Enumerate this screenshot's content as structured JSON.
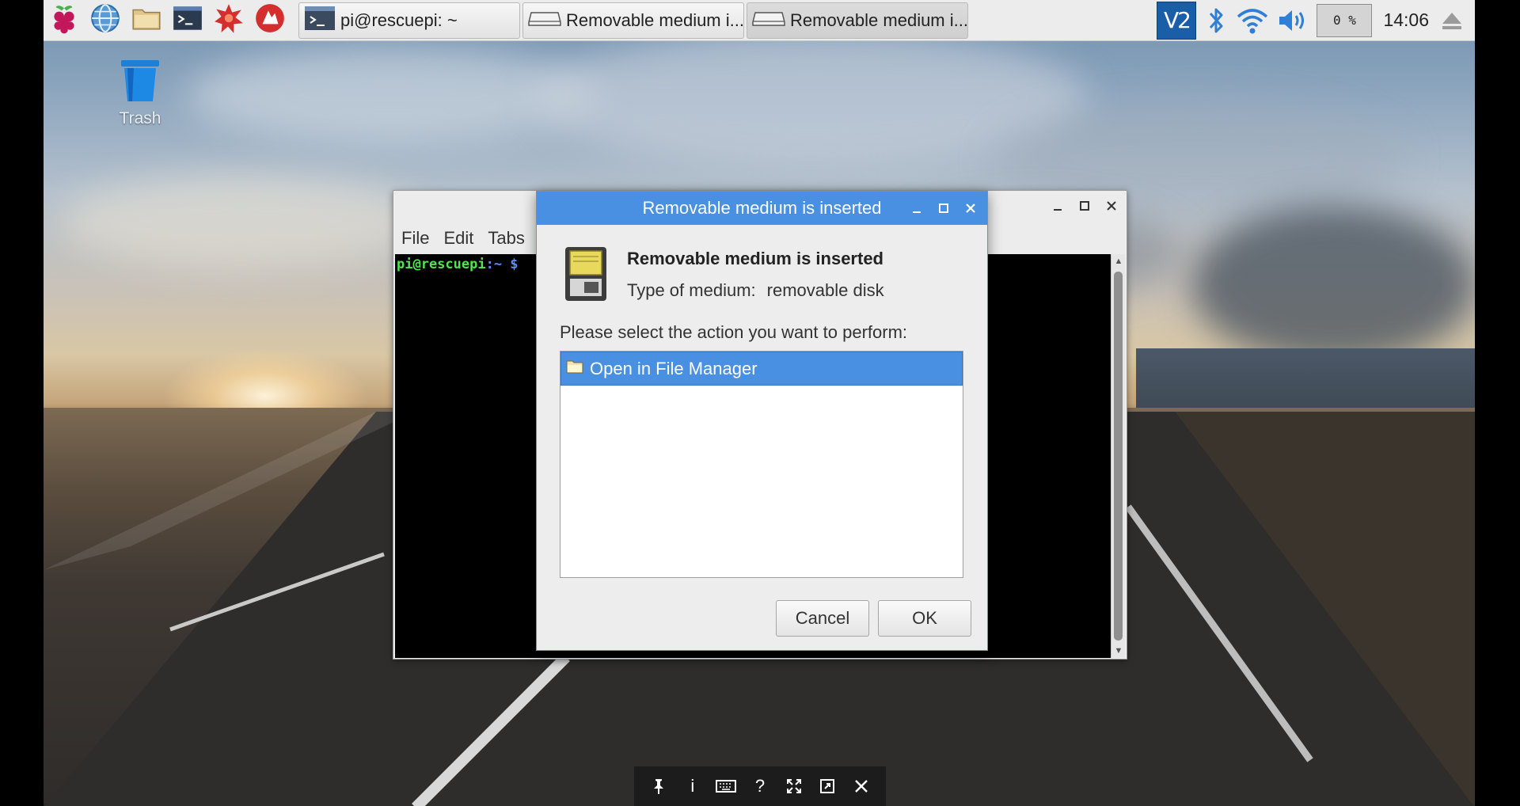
{
  "desktop": {
    "trash_label": "Trash"
  },
  "taskbar": {
    "launchers": [
      "raspberry-menu-icon",
      "web-browser-icon",
      "file-manager-icon",
      "terminal-icon",
      "mathematica-icon",
      "wolfram-icon"
    ],
    "windows": [
      {
        "label": "pi@rescuepi: ~",
        "icon": "terminal-icon",
        "active": false
      },
      {
        "label": "Removable medium i...",
        "icon": "drive-icon",
        "active": false
      },
      {
        "label": "Removable medium i...",
        "icon": "drive-icon",
        "active": true
      }
    ],
    "tray": {
      "vnc_label": "V2",
      "cpu_text": "0 %",
      "clock": "14:06"
    }
  },
  "terminal": {
    "menu": [
      "File",
      "Edit",
      "Tabs"
    ],
    "prompt_user": "pi@rescuepi",
    "prompt_path": ":~ $"
  },
  "dialog": {
    "title": "Removable medium is inserted",
    "heading": "Removable medium is inserted",
    "type_label": "Type of medium:",
    "type_value": "removable disk",
    "prompt": "Please select the action you want to perform:",
    "actions": [
      {
        "label": "Open in File Manager",
        "icon": "folder-icon",
        "selected": true
      }
    ],
    "cancel_label": "Cancel",
    "ok_label": "OK"
  },
  "vnc_toolbar": {
    "items": [
      "pin-icon",
      "info-icon",
      "keyboard-icon",
      "help-icon",
      "fullscreen-icon",
      "scale-icon",
      "close-icon"
    ]
  },
  "colors": {
    "accent": "#4a90e2",
    "taskbar_bg": "#ececec",
    "terminal_bg": "#000000",
    "prompt_user": "#4ee64e",
    "prompt_path": "#5c8cff"
  }
}
